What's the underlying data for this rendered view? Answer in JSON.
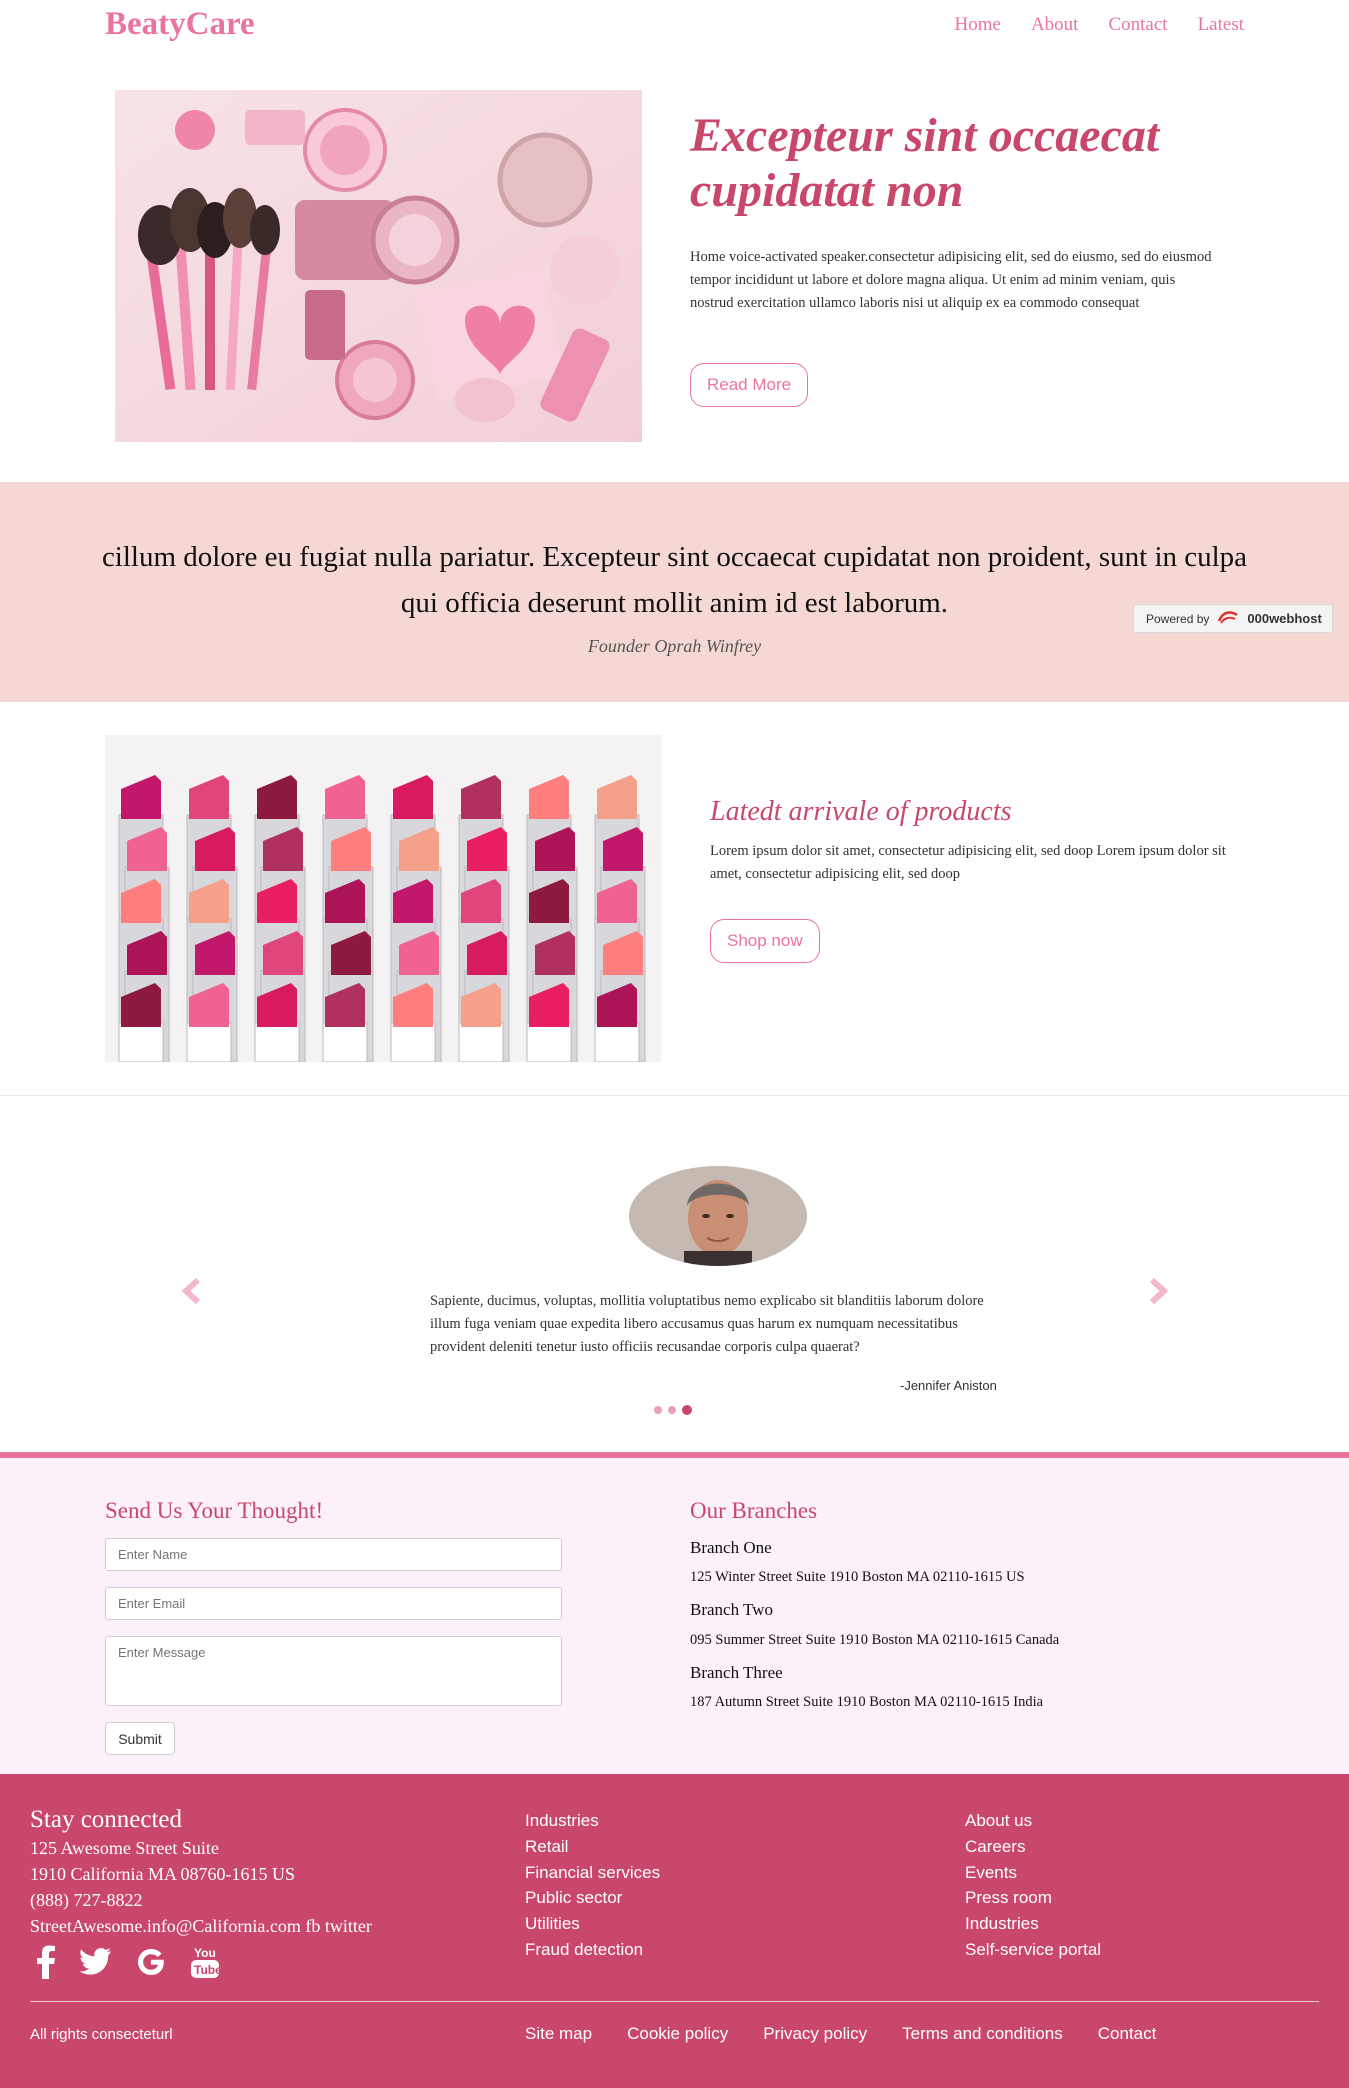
{
  "nav": {
    "brand": "BeatyCare",
    "links": [
      "Home",
      "About",
      "Contact",
      "Latest"
    ]
  },
  "hero": {
    "title": "Excepteur sint occaecat cupidatat non",
    "body": "Home voice-activated speaker.consectetur adipisicing elit, sed do eiusmo, sed do eiusmod tempor incididunt ut labore et dolore magna aliqua. Ut enim ad minim veniam, quis nostrud exercitation ullamco laboris nisi ut aliquip ex ea commodo consequat",
    "button": "Read More"
  },
  "quote": {
    "text": "cillum dolore eu fugiat nulla pariatur. Excepteur sint occaecat cupidatat non proident, sunt in culpa qui officia deserunt mollit anim id est laborum.",
    "author": "Founder Oprah Winfrey"
  },
  "powered": {
    "label": "Powered by",
    "logo": "000webhost"
  },
  "products": {
    "title": "Latedt arrivale of products",
    "body": "Lorem ipsum dolor sit amet, consectetur adipisicing elit, sed doop Lorem ipsum dolor sit amet, consectetur adipisicing elit, sed doop",
    "button": "Shop now"
  },
  "testimonial": {
    "text": "Sapiente, ducimus, voluptas, mollitia voluptatibus nemo explicabo sit blanditiis laborum dolore illum fuga veniam quae expedita libero accusamus quas harum ex numquam necessitatibus provident deleniti tenetur iusto officiis recusandae corporis culpa quaerat?",
    "author": "-Jennifer Aniston",
    "active_slide": 3,
    "slide_count": 3
  },
  "contact_form": {
    "title": "Send Us Your Thought!",
    "name_placeholder": "Enter Name",
    "email_placeholder": "Enter Email",
    "message_placeholder": "Enter Message",
    "submit": "Submit"
  },
  "branches": {
    "title": "Our Branches",
    "items": [
      {
        "name": "Branch One",
        "address": "125 Winter Street Suite 1910 Boston MA 02110-1615 US"
      },
      {
        "name": "Branch Two",
        "address": "095 Summer Street Suite 1910 Boston MA 02110-1615 Canada"
      },
      {
        "name": "Branch Three",
        "address": "187 Autumn Street Suite 1910 Boston MA 02110-1615 India"
      }
    ]
  },
  "footer": {
    "title": "Stay connected",
    "address_lines": [
      "125 Awesome Street Suite",
      "1910 California MA 08760-1615 US",
      "(888) 727-8822",
      "StreetAwesome.info@California.com fb twitter"
    ],
    "social_icons": [
      "facebook-icon",
      "twitter-icon",
      "google-icon",
      "youtube-icon"
    ],
    "col1": [
      "Industries",
      "Retail",
      "Financial services",
      "Public sector",
      "Utilities",
      "Fraud detection"
    ],
    "col2": [
      "About us",
      "Careers",
      "Events",
      "Press room",
      "Industries",
      "Self-service portal"
    ],
    "rights": "All rights consecteturl",
    "bottom_links": [
      "Site map",
      "Cookie policy",
      "Privacy policy",
      "Terms and conditions",
      "Contact"
    ]
  },
  "colors": {
    "brand_pink": "#e9759e",
    "accent": "#c8476b",
    "quote_band": "#f5d8d4",
    "contact_bg": "#fcf0fb",
    "footer_bg": "#c8476b"
  }
}
